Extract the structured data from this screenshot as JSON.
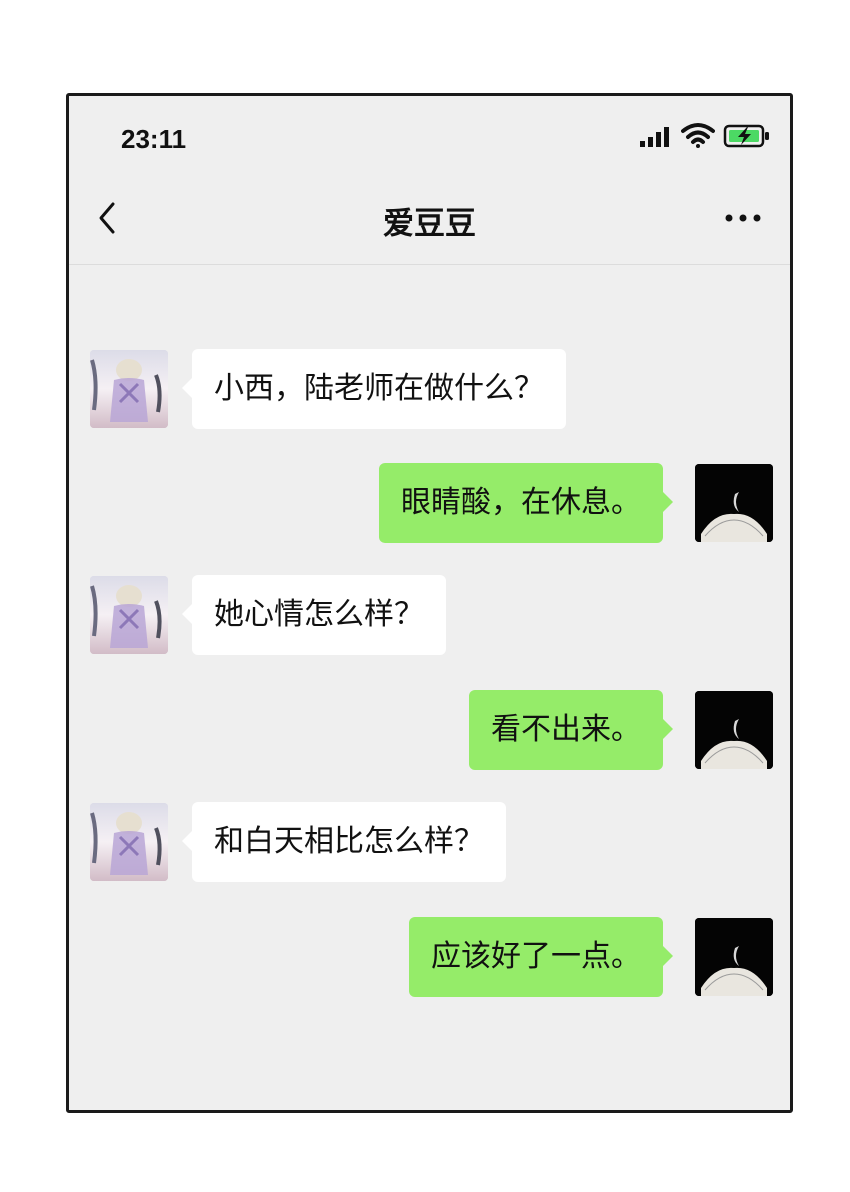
{
  "status_bar": {
    "time": "23:11"
  },
  "header": {
    "back_icon": "chevron-left-icon",
    "title": "爱豆豆",
    "more_icon": "more-dots-icon"
  },
  "colors": {
    "background": "#efefef",
    "incoming_bubble": "#ffffff",
    "outgoing_bubble": "#95ec69"
  },
  "messages": [
    {
      "sender": "contact",
      "text": "小西，陆老师在做什么？"
    },
    {
      "sender": "self",
      "text": "眼睛酸，在休息。"
    },
    {
      "sender": "contact",
      "text": "她心情怎么样？"
    },
    {
      "sender": "self",
      "text": "看不出来。"
    },
    {
      "sender": "contact",
      "text": "和白天相比怎么样？"
    },
    {
      "sender": "self",
      "text": "应该好了一点。"
    }
  ]
}
